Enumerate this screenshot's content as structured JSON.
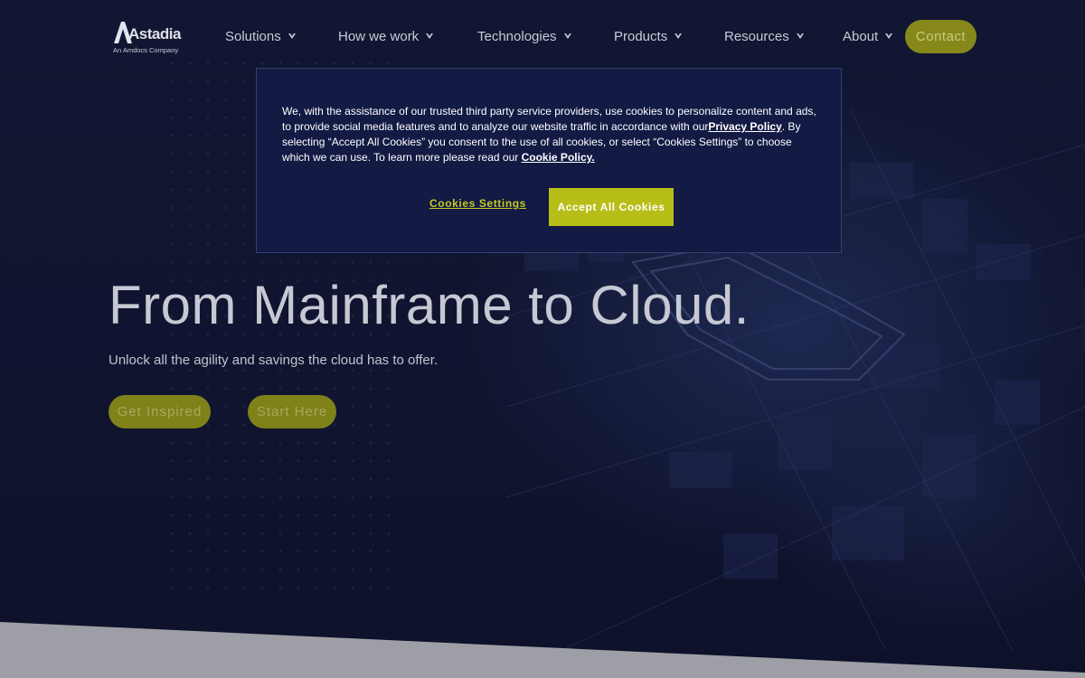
{
  "brand": {
    "name": "Astadia",
    "tagline": "An Amdocs Company"
  },
  "nav": {
    "items": [
      {
        "label": "Solutions"
      },
      {
        "label": "How we work"
      },
      {
        "label": "Technologies"
      },
      {
        "label": "Products"
      },
      {
        "label": "Resources"
      },
      {
        "label": "About"
      }
    ],
    "contact_label": "Contact"
  },
  "hero": {
    "title": "From Mainframe to Cloud.",
    "subtitle": "Unlock all the agility and savings the cloud has to offer.",
    "primary_cta": "Get Inspired",
    "secondary_cta": "Start Here"
  },
  "cookie_banner": {
    "text_part1": "We, with the assistance of our trusted third party service providers, use cookies to personalize content and ads, to provide social media features and to analyze our website traffic in accordance with our",
    "privacy_link": "Privacy Policy",
    "text_part2": ". By selecting “Accept All Cookies” you consent to the use of all cookies, or select “Cookies Settings” to choose which we can use. To learn more please read our ",
    "cookie_link": "Cookie Policy.",
    "settings_label": "Cookies Settings",
    "accept_label": "Accept All Cookies"
  },
  "colors": {
    "background": "#141a38",
    "accent": "#b8be18",
    "dialog": "#131a44",
    "footer_band": "#9e9ea6"
  },
  "icons": {
    "nav_caret": "chevron-down-icon"
  }
}
